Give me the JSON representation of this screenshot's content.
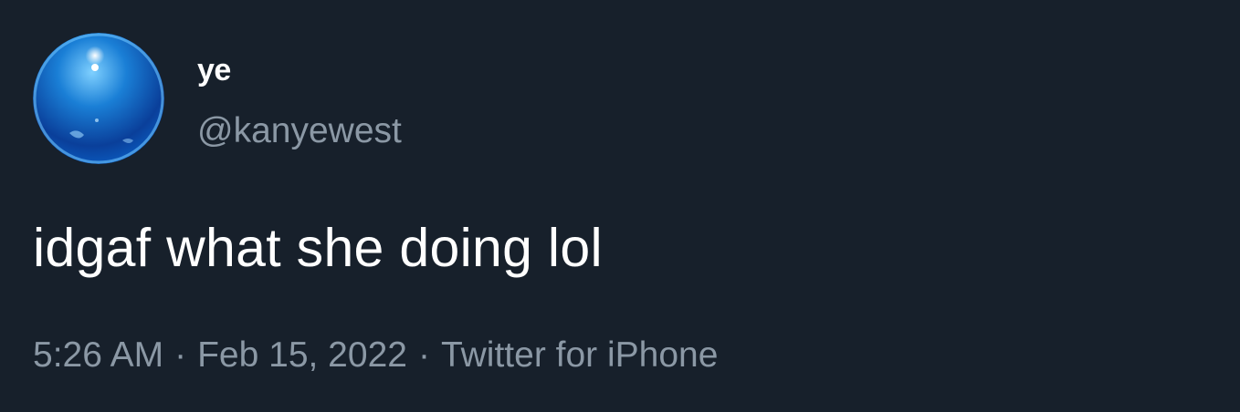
{
  "author": {
    "display_name": "ye",
    "handle": "@kanyewest",
    "avatar": "blue-globe-avatar"
  },
  "tweet": {
    "text": "idgaf what she doing lol"
  },
  "meta": {
    "time": "5:26 AM",
    "separator": "·",
    "date": "Feb 15, 2022",
    "source": "Twitter for iPhone"
  },
  "colors": {
    "background": "#17202b",
    "primary_text": "#ffffff",
    "secondary_text": "#8b98a5",
    "avatar_blue": "#1a7fd6"
  }
}
